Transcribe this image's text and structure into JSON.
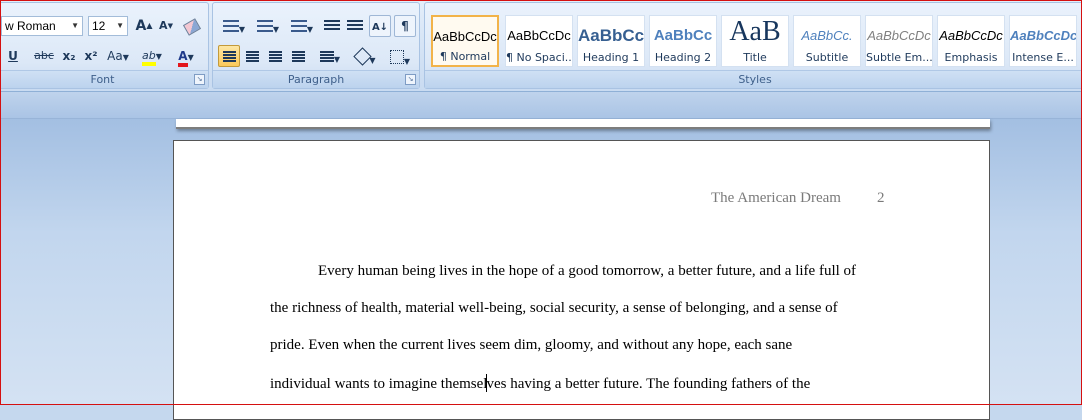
{
  "font_group": {
    "font_name": "w Roman",
    "font_size": "12",
    "grow_label": "A",
    "shrink_label": "A",
    "underline_label": "U",
    "strike_label": "abc",
    "subscript_label": "x₂",
    "superscript_label": "x²",
    "change_case_label": "Aa",
    "highlight_label": "ab",
    "font_color_label": "A",
    "group_label": "Font"
  },
  "paragraph_group": {
    "group_label": "Paragraph"
  },
  "styles_group": {
    "group_label": "Styles",
    "tiles": [
      {
        "sample": "AaBbCcDc",
        "name": "¶ Normal"
      },
      {
        "sample": "AaBbCcDc",
        "name": "¶ No Spaci..."
      },
      {
        "sample": "AaBbCc",
        "name": "Heading 1"
      },
      {
        "sample": "AaBbCc",
        "name": "Heading 2"
      },
      {
        "sample": "AaB",
        "name": "Title"
      },
      {
        "sample": "AaBbCc.",
        "name": "Subtitle"
      },
      {
        "sample": "AaBbCcDc",
        "name": "Subtle Em..."
      },
      {
        "sample": "AaBbCcDc",
        "name": "Emphasis"
      },
      {
        "sample": "AaBbCcDc",
        "name": "Intense E..."
      }
    ]
  },
  "document": {
    "header_title": "The American Dream",
    "page_number": "2",
    "lines": [
      "Every human being lives in the hope of a good tomorrow, a better future, and a life full of",
      "the richness of health, material well-being, social security, a sense of belonging, and a sense of",
      "pride. Even when the current lives seem dim, gloomy, and without any hope, each sane",
      "individual wants to imagine themsel",
      "ves having a better future. The founding fathers of the"
    ]
  },
  "colors": {
    "highlight": "#ffff00",
    "font_color": "#e3161b",
    "active_style_border": "#f2b349"
  }
}
